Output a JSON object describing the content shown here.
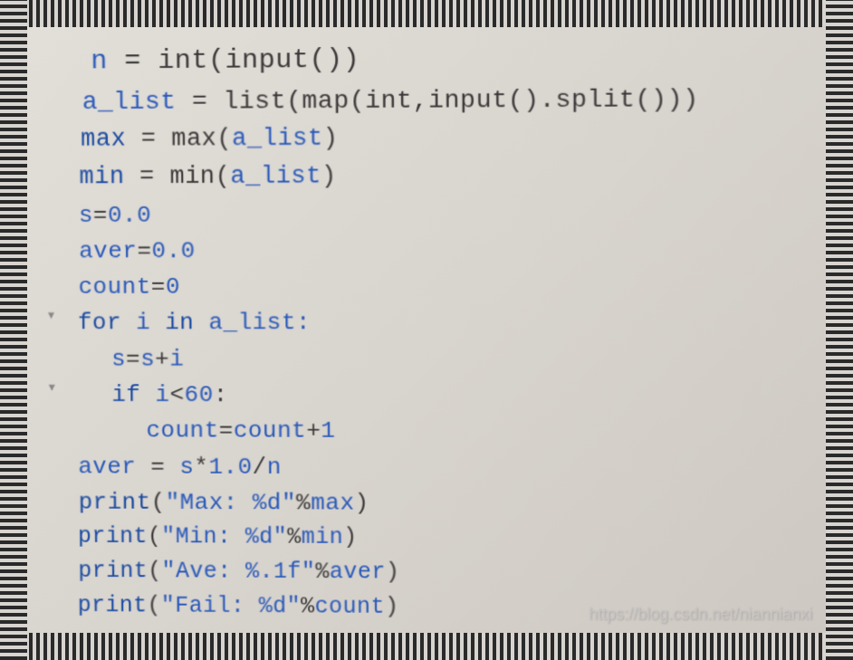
{
  "code": {
    "lines": [
      {
        "cls": "l1",
        "marker": "",
        "tokens": [
          {
            "t": "n",
            "c": "var"
          },
          {
            "t": " = ",
            "c": "op"
          },
          {
            "t": "int",
            "c": "builtin"
          },
          {
            "t": "(",
            "c": "paren"
          },
          {
            "t": "input",
            "c": "builtin"
          },
          {
            "t": "())",
            "c": "paren"
          }
        ]
      },
      {
        "cls": "l2",
        "marker": "",
        "tokens": [
          {
            "t": "a_list",
            "c": "var"
          },
          {
            "t": " = ",
            "c": "op"
          },
          {
            "t": "list",
            "c": "builtin"
          },
          {
            "t": "(",
            "c": "paren"
          },
          {
            "t": "map",
            "c": "builtin"
          },
          {
            "t": "(",
            "c": "paren"
          },
          {
            "t": "int",
            "c": "builtin"
          },
          {
            "t": ",",
            "c": "op"
          },
          {
            "t": "input",
            "c": "builtin"
          },
          {
            "t": "().",
            "c": "paren"
          },
          {
            "t": "split",
            "c": "builtin"
          },
          {
            "t": "()))",
            "c": "paren"
          }
        ]
      },
      {
        "cls": "l3",
        "marker": "",
        "tokens": [
          {
            "t": "max",
            "c": "kw"
          },
          {
            "t": " = ",
            "c": "op"
          },
          {
            "t": "max",
            "c": "builtin"
          },
          {
            "t": "(",
            "c": "paren"
          },
          {
            "t": "a_list",
            "c": "var"
          },
          {
            "t": ")",
            "c": "paren"
          }
        ]
      },
      {
        "cls": "l4",
        "marker": "",
        "tokens": [
          {
            "t": "min",
            "c": "kw"
          },
          {
            "t": " = ",
            "c": "op"
          },
          {
            "t": "min",
            "c": "builtin"
          },
          {
            "t": "(",
            "c": "paren"
          },
          {
            "t": "a_list",
            "c": "var"
          },
          {
            "t": ")",
            "c": "paren"
          }
        ]
      },
      {
        "cls": "l5",
        "marker": "",
        "tokens": [
          {
            "t": "s",
            "c": "var"
          },
          {
            "t": "=",
            "c": "op"
          },
          {
            "t": "0.0",
            "c": "num"
          }
        ]
      },
      {
        "cls": "l6",
        "marker": "",
        "tokens": [
          {
            "t": "aver",
            "c": "var"
          },
          {
            "t": "=",
            "c": "op"
          },
          {
            "t": "0.0",
            "c": "num"
          }
        ]
      },
      {
        "cls": "l7",
        "marker": "",
        "tokens": [
          {
            "t": "count",
            "c": "var"
          },
          {
            "t": "=",
            "c": "op"
          },
          {
            "t": "0",
            "c": "num"
          }
        ]
      },
      {
        "cls": "l8",
        "marker": "▾",
        "tokens": [
          {
            "t": "for",
            "c": "kw"
          },
          {
            "t": " i ",
            "c": "var"
          },
          {
            "t": "in",
            "c": "kw"
          },
          {
            "t": " a_list:",
            "c": "var"
          }
        ]
      },
      {
        "cls": "l9",
        "marker": "",
        "tokens": [
          {
            "t": "s",
            "c": "var"
          },
          {
            "t": "=",
            "c": "op"
          },
          {
            "t": "s",
            "c": "var"
          },
          {
            "t": "+",
            "c": "op"
          },
          {
            "t": "i",
            "c": "var"
          }
        ]
      },
      {
        "cls": "l10",
        "marker": "▾",
        "tokens": [
          {
            "t": "if",
            "c": "kw"
          },
          {
            "t": " i",
            "c": "var"
          },
          {
            "t": "<",
            "c": "op"
          },
          {
            "t": "60",
            "c": "num"
          },
          {
            "t": ":",
            "c": "op"
          }
        ]
      },
      {
        "cls": "l11",
        "marker": "",
        "tokens": [
          {
            "t": "count",
            "c": "var"
          },
          {
            "t": "=",
            "c": "op"
          },
          {
            "t": "count",
            "c": "var"
          },
          {
            "t": "+",
            "c": "op"
          },
          {
            "t": "1",
            "c": "num"
          }
        ]
      },
      {
        "cls": "l12",
        "marker": "",
        "tokens": [
          {
            "t": "aver",
            "c": "var"
          },
          {
            "t": " = ",
            "c": "op"
          },
          {
            "t": "s",
            "c": "var"
          },
          {
            "t": "*",
            "c": "op"
          },
          {
            "t": "1.0",
            "c": "num"
          },
          {
            "t": "/",
            "c": "op"
          },
          {
            "t": "n",
            "c": "var"
          }
        ]
      },
      {
        "cls": "l13",
        "marker": "",
        "tokens": [
          {
            "t": "print",
            "c": "kw"
          },
          {
            "t": "(",
            "c": "paren"
          },
          {
            "t": "\"Max: %d\"",
            "c": "str"
          },
          {
            "t": "%",
            "c": "op"
          },
          {
            "t": "max",
            "c": "var"
          },
          {
            "t": ")",
            "c": "paren"
          }
        ]
      },
      {
        "cls": "l14",
        "marker": "",
        "tokens": [
          {
            "t": "print",
            "c": "kw"
          },
          {
            "t": "(",
            "c": "paren"
          },
          {
            "t": "\"Min: %d\"",
            "c": "str"
          },
          {
            "t": "%",
            "c": "op"
          },
          {
            "t": "min",
            "c": "var"
          },
          {
            "t": ")",
            "c": "paren"
          }
        ]
      },
      {
        "cls": "l15",
        "marker": "",
        "tokens": [
          {
            "t": "print",
            "c": "kw"
          },
          {
            "t": "(",
            "c": "paren"
          },
          {
            "t": "\"Ave: %.1f\"",
            "c": "str"
          },
          {
            "t": "%",
            "c": "op"
          },
          {
            "t": "aver",
            "c": "var"
          },
          {
            "t": ")",
            "c": "paren"
          }
        ]
      },
      {
        "cls": "l16",
        "marker": "",
        "tokens": [
          {
            "t": "print",
            "c": "kw"
          },
          {
            "t": "(",
            "c": "paren"
          },
          {
            "t": "\"Fail: %d\"",
            "c": "str"
          },
          {
            "t": "%",
            "c": "op"
          },
          {
            "t": "count",
            "c": "var"
          },
          {
            "t": ")",
            "c": "paren"
          }
        ]
      }
    ]
  },
  "watermark": "https://blog.csdn.net/niannianxi"
}
